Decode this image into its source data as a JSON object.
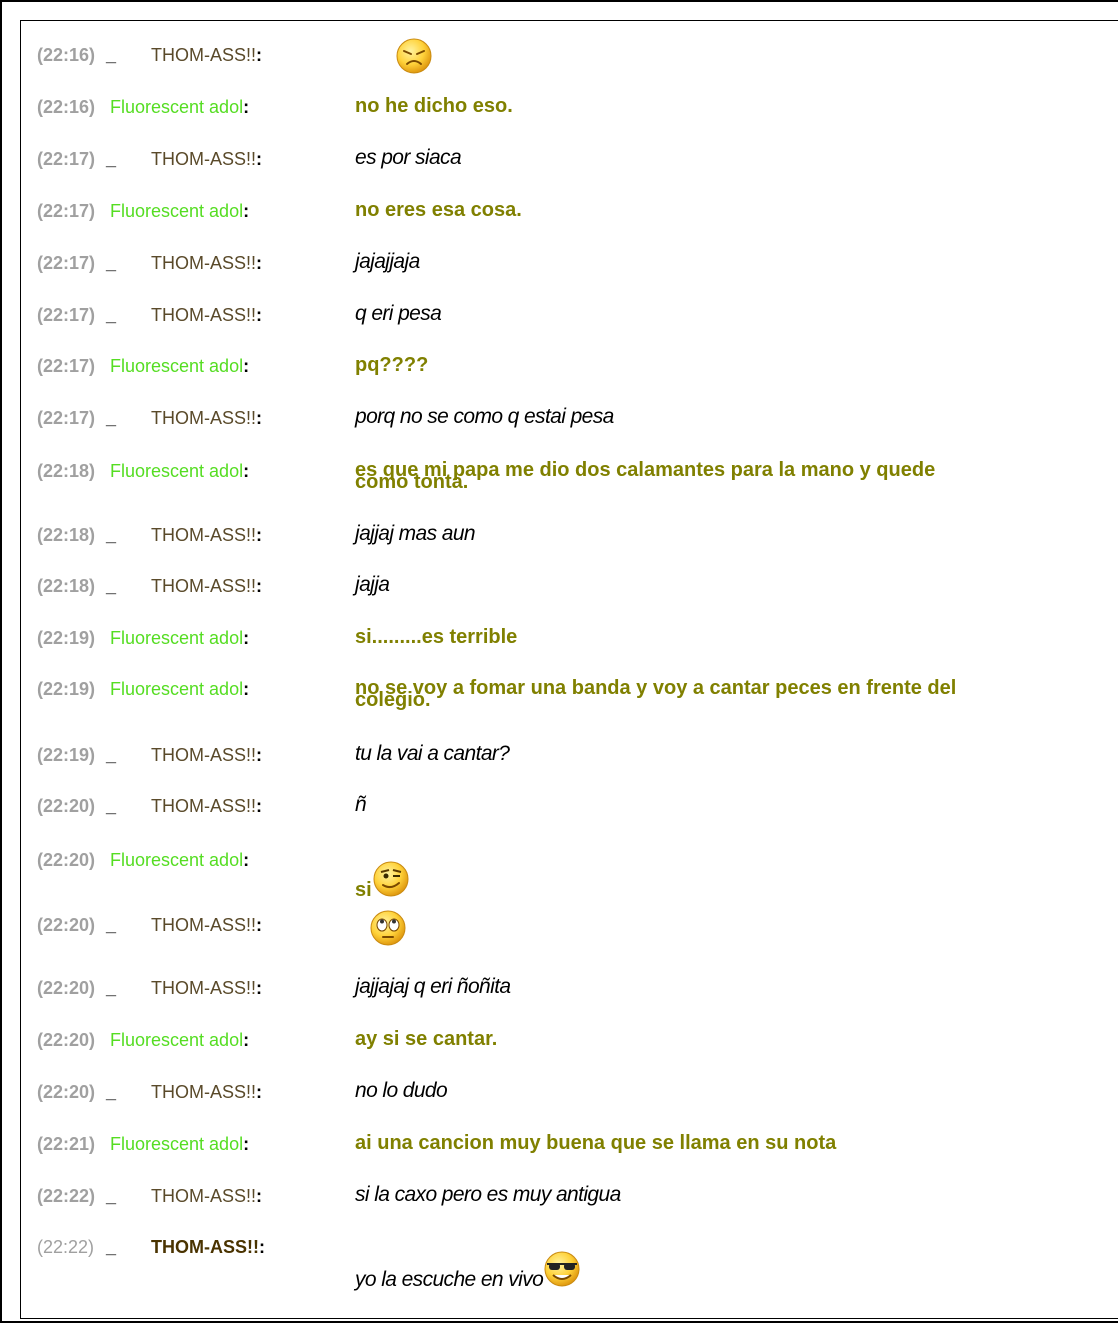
{
  "nick_thom": "THOM-ASS!!",
  "nick_fluo": "Fluorescent adol",
  "prefix": "_",
  "colon": ":",
  "messages": [
    {
      "time": "(22:16)",
      "who": "thom",
      "text": "",
      "emoticon": "angry-face-icon"
    },
    {
      "time": "(22:16)",
      "who": "fluo",
      "text": "no he dicho eso."
    },
    {
      "time": "(22:17)",
      "who": "thom",
      "text": "es por siaca"
    },
    {
      "time": "(22:17)",
      "who": "fluo",
      "text": "no eres esa cosa."
    },
    {
      "time": "(22:17)",
      "who": "thom",
      "text": "jajajjaja"
    },
    {
      "time": "(22:17)",
      "who": "thom",
      "text": "q eri pesa"
    },
    {
      "time": "(22:17)",
      "who": "fluo",
      "text": "pq????"
    },
    {
      "time": "(22:17)",
      "who": "thom",
      "text": "porq no se como q estai pesa"
    },
    {
      "time": "(22:18)",
      "who": "fluo",
      "text": "es que mi papa me dio dos calamantes para la mano y quede",
      "text2": "como tonta."
    },
    {
      "time": "(22:18)",
      "who": "thom",
      "text": "jajjaj mas aun"
    },
    {
      "time": "(22:18)",
      "who": "thom",
      "text": "jajja"
    },
    {
      "time": "(22:19)",
      "who": "fluo",
      "text": "si.........es terrible"
    },
    {
      "time": "(22:19)",
      "who": "fluo",
      "text": "no se voy a fomar una banda y voy a cantar peces en frente del",
      "text2": "colegio."
    },
    {
      "time": "(22:19)",
      "who": "thom",
      "text": "tu la vai  a cantar?"
    },
    {
      "time": "(22:20)",
      "who": "thom",
      "text": "ñ"
    },
    {
      "time": "(22:20)",
      "who": "fluo",
      "text": "si",
      "emoticon": "wink-face-icon"
    },
    {
      "time": "(22:20)",
      "who": "thom",
      "text": "",
      "emoticon": "eye-roll-face-icon"
    },
    {
      "time": "(22:20)",
      "who": "thom",
      "text": "jajjajaj q eri ñoñita"
    },
    {
      "time": "(22:20)",
      "who": "fluo",
      "text": "ay si se cantar."
    },
    {
      "time": "(22:20)",
      "who": "thom",
      "text": "no lo dudo"
    },
    {
      "time": "(22:21)",
      "who": "fluo",
      "text": "ai una cancion muy buena que se llama en su nota"
    },
    {
      "time": "(22:22)",
      "who": "thom",
      "text": "si la caxo pero es muy antigua"
    },
    {
      "time": "(22:22)",
      "who": "thom",
      "text": "yo la escuche en vivo",
      "emoticon": "sunglasses-face-icon",
      "variant": "last"
    }
  ]
}
